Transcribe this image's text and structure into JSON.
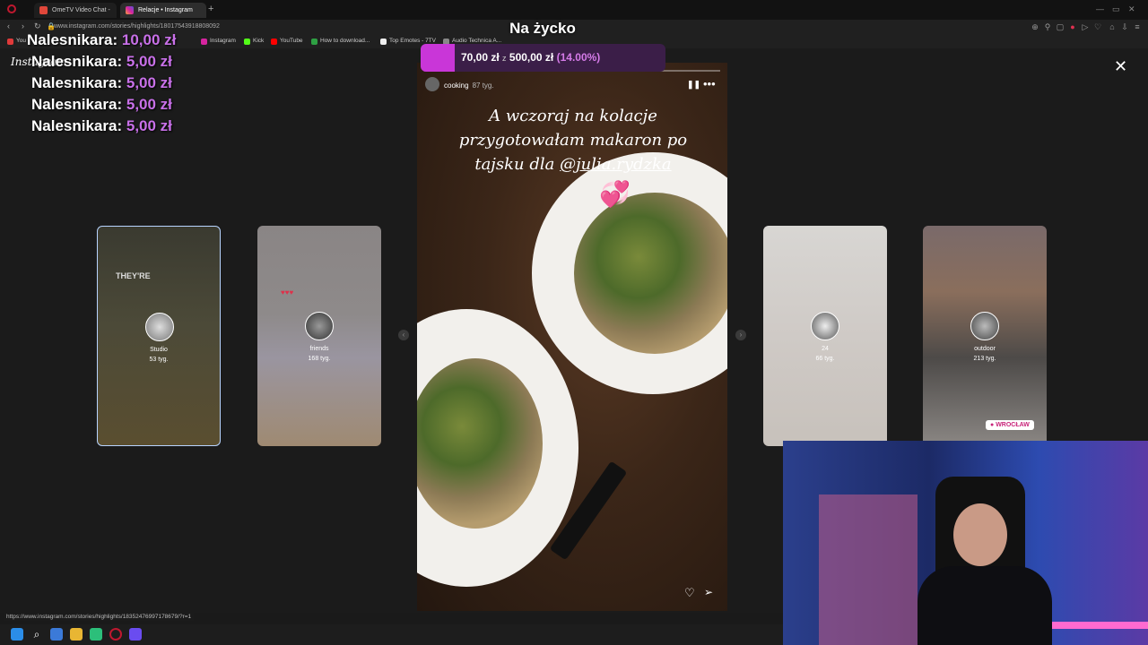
{
  "browser": {
    "tabs": [
      {
        "label": "OmeTV Video Chat -",
        "active": false
      },
      {
        "label": "Relacje • Instagram",
        "active": true
      }
    ],
    "new_tab": "+",
    "url": "www.instagram.com/stories/highlights/18017543918808092",
    "bookmarks": [
      "You",
      "Instagram",
      "Kick",
      "YouTube",
      "How to download...",
      "Top Emotes - 7TV",
      "Audio Technica A..."
    ],
    "status_url": "https://www.instagram.com/stories/highlights/18352476997178679/?r=1"
  },
  "instagram": {
    "logo": "Instagram",
    "close_icon": "close-icon",
    "story": {
      "username": "cooking",
      "time": "87 tyg.",
      "text_line1": "A wczoraj na kolacje",
      "text_line2": "przygotowałam makaron po",
      "text_line3_prefix": "tajsku dla",
      "mention": "@julia.rydzka",
      "sticker": "💞"
    },
    "highlights": [
      {
        "title": "Studio",
        "time": "53 tyg.",
        "headline": "THEY'RE",
        "selected": true
      },
      {
        "title": "friends",
        "time": "168 tyg.",
        "selected": false
      },
      {
        "title": "24",
        "time": "66 tyg.",
        "selected": false
      },
      {
        "title": "outdoor",
        "time": "213 tyg.",
        "location": "WROCŁAW",
        "selected": false
      }
    ]
  },
  "stream_overlay": {
    "title": "Na życko",
    "goal": {
      "current": "70,00 zł",
      "separator": "z",
      "target": "500,00 zł",
      "percent": "(14.00%)",
      "fraction": 0.14,
      "fill_color": "#c936d8"
    },
    "donations": [
      {
        "name": "Nalesnikara:",
        "amount": "10,00 zł"
      },
      {
        "name": "Nalesnikara:",
        "amount": "5,00 zł"
      },
      {
        "name": "Nalesnikara:",
        "amount": "5,00 zł"
      },
      {
        "name": "Nalesnikara:",
        "amount": "5,00 zł"
      },
      {
        "name": "Nalesnikara:",
        "amount": "5,00 zł"
      }
    ]
  },
  "colors": {
    "accent": "#c936d8",
    "instagram_bg": "#1b1b1b"
  }
}
